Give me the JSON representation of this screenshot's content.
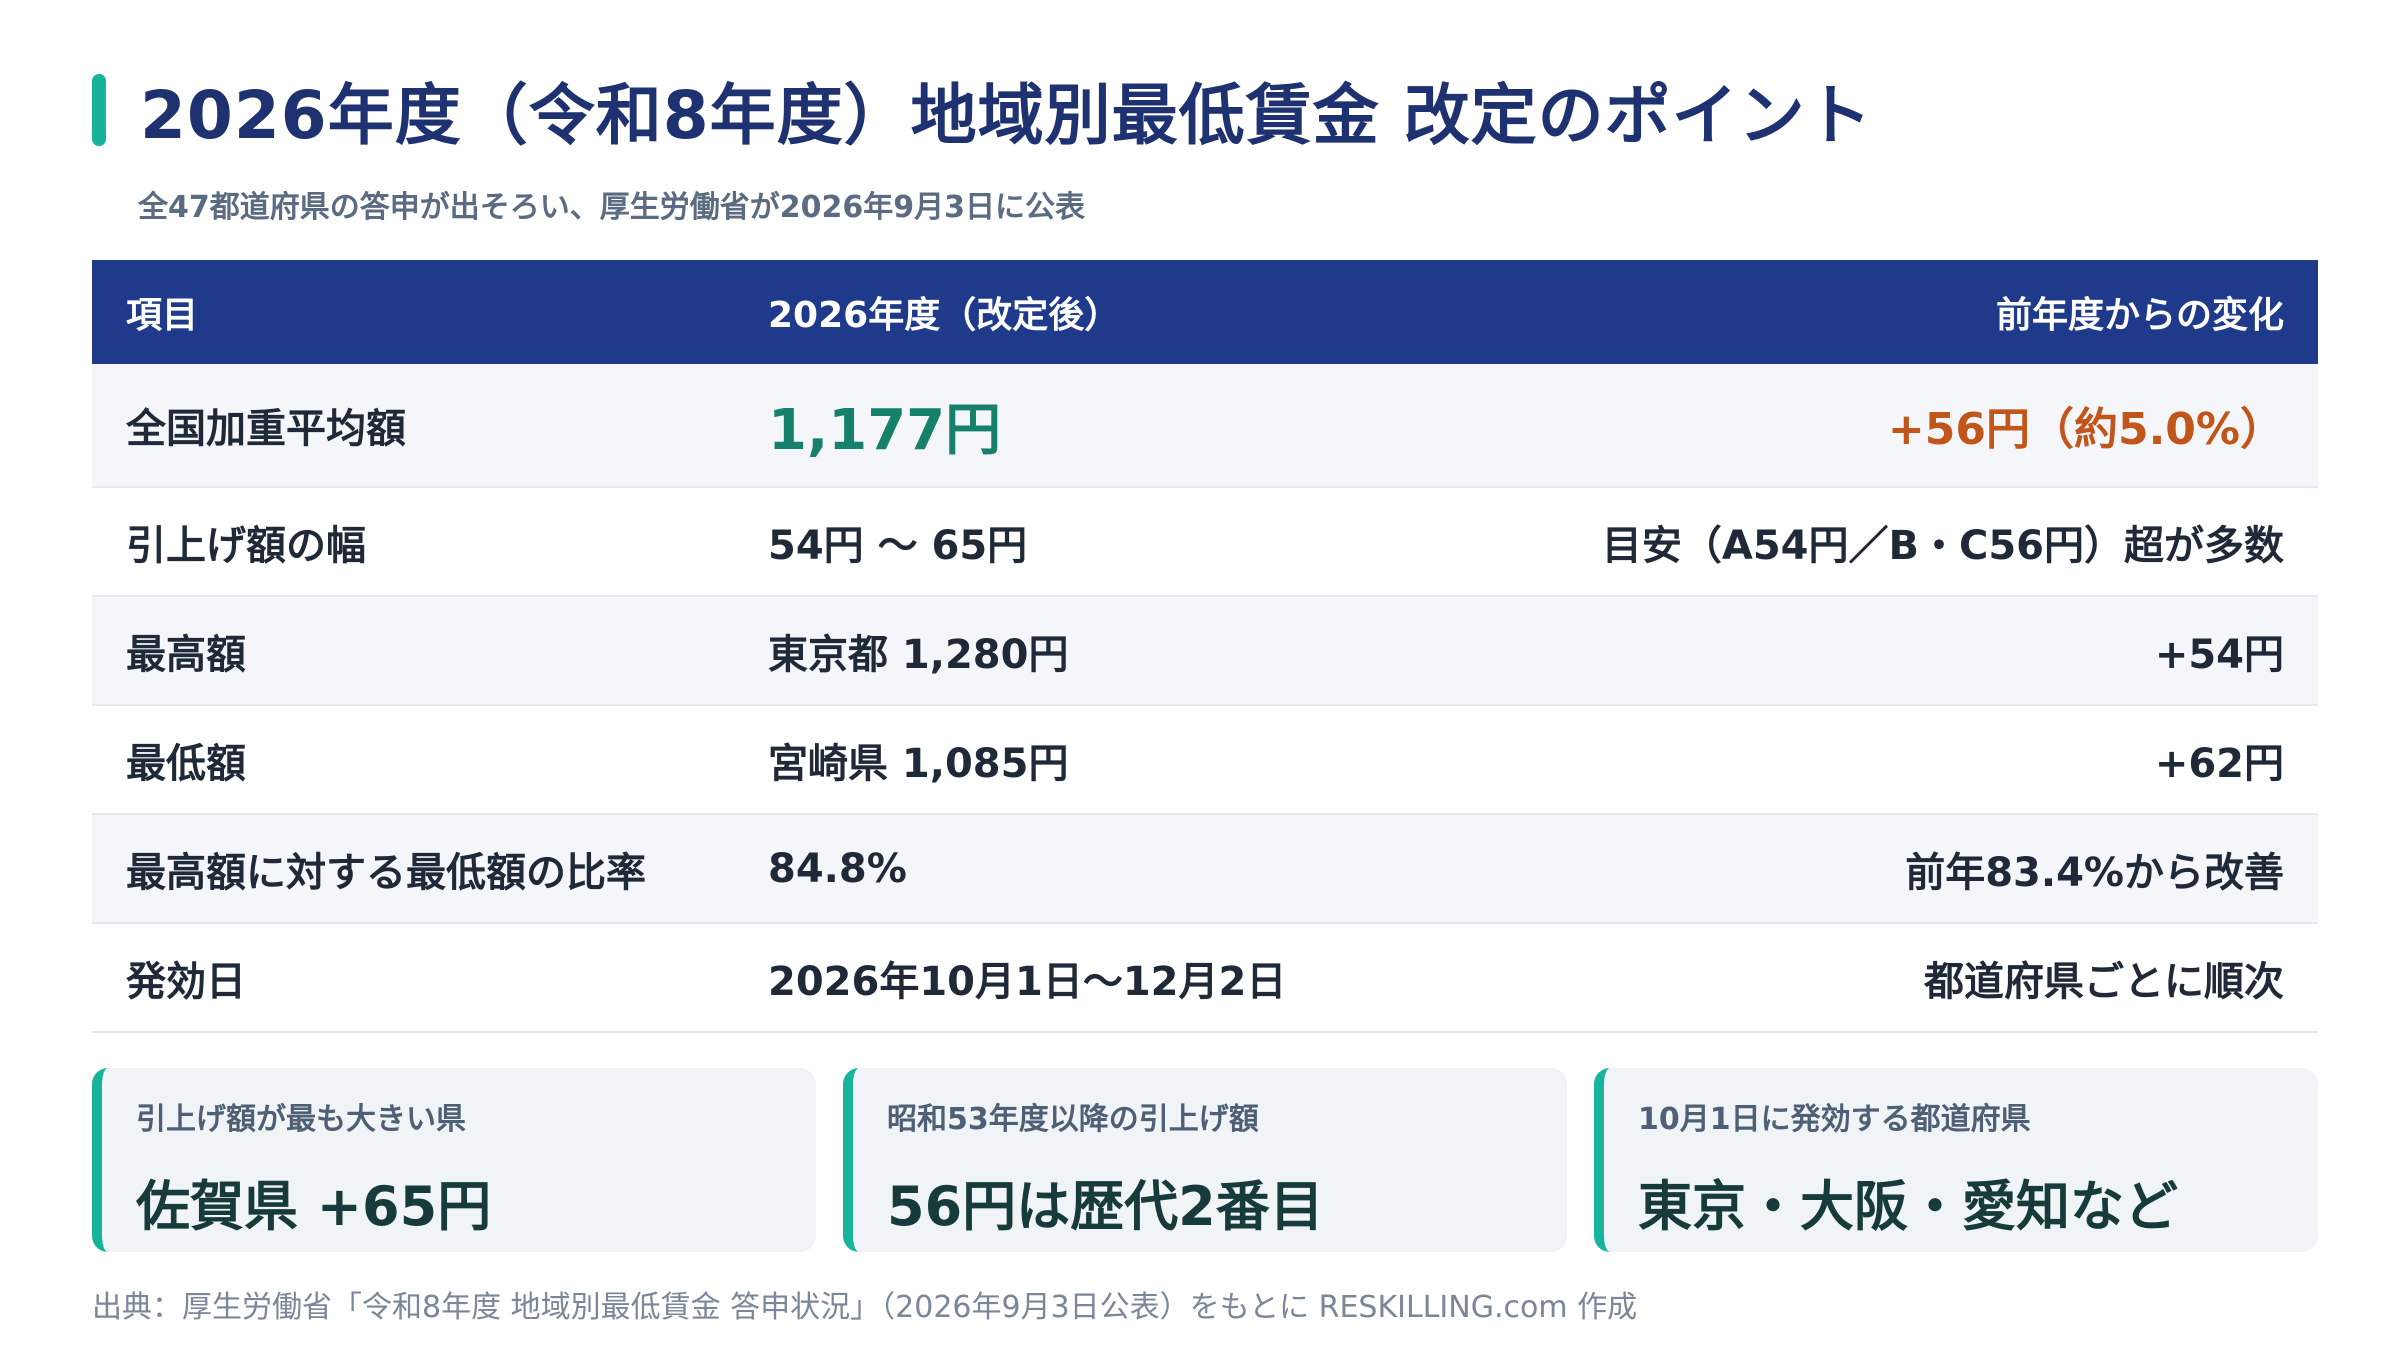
{
  "header": {
    "title": "2026年度（令和8年度）地域別最低賃金 改定のポイント",
    "subtitle": "全47都道府県の答申が出そろい、厚生労働省が2026年9月3日に公表"
  },
  "table": {
    "columns": [
      "項目",
      "2026年度（改定後）",
      "前年度からの変化"
    ],
    "rows": [
      {
        "item": "全国加重平均額",
        "value": "1,177円",
        "change": "+56円（約5.0%）"
      },
      {
        "item": "引上げ額の幅",
        "value": "54円 〜 65円",
        "change": "目安（A54円／B・C56円）超が多数"
      },
      {
        "item": "最高額",
        "value": "東京都 1,280円",
        "change": "+54円"
      },
      {
        "item": "最低額",
        "value": "宮崎県 1,085円",
        "change": "+62円"
      },
      {
        "item": "最高額に対する最低額の比率",
        "value": "84.8%",
        "change": "前年83.4%から改善"
      },
      {
        "item": "発効日",
        "value": "2026年10月1日〜12月2日",
        "change": "都道府県ごとに順次"
      }
    ]
  },
  "cards": [
    {
      "label": "引上げ額が最も大きい県",
      "value": "佐賀県 +65円"
    },
    {
      "label": "昭和53年度以降の引上げ額",
      "value": "56円は歴代2番目"
    },
    {
      "label": "10月1日に発効する都道府県",
      "value": "東京・大阪・愛知など"
    }
  ],
  "source": "出典：厚生労働省「令和8年度 地域別最低賃金 答申状況」（2026年9月3日公表）をもとに RESKILLING.com 作成",
  "colors": {
    "accent": "#17b39b",
    "header_bg": "#1f3a8a",
    "title_text": "#1e3170",
    "highlight_value": "#16806b",
    "highlight_change": "#c2561a"
  }
}
